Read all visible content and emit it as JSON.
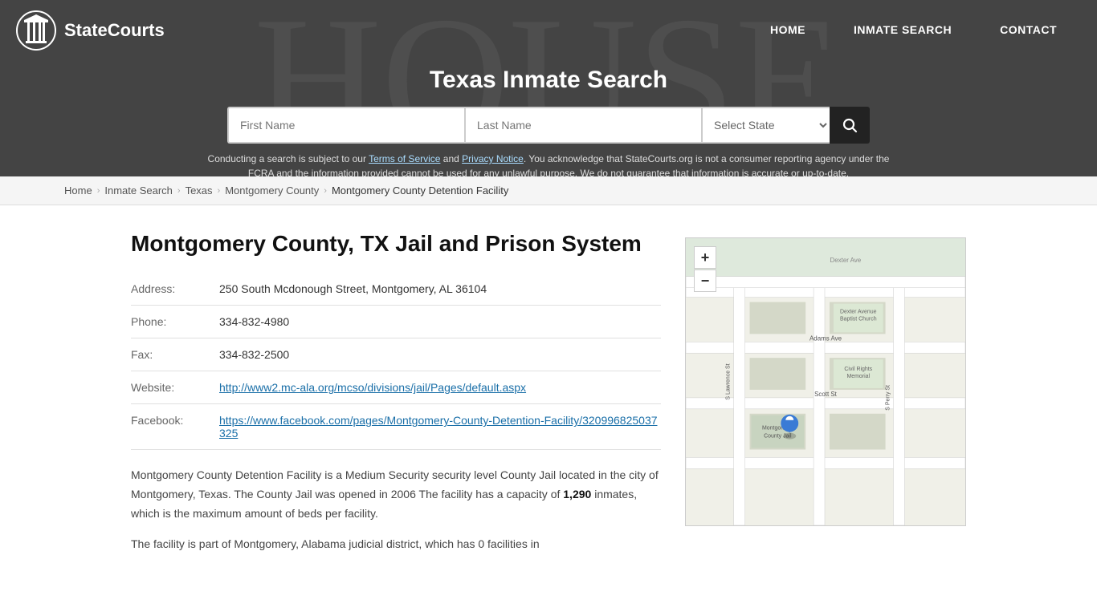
{
  "site": {
    "name": "StateCourts",
    "logo_alt": "StateCourts logo"
  },
  "nav": {
    "home_label": "HOME",
    "inmate_search_label": "INMATE SEARCH",
    "contact_label": "CONTACT"
  },
  "hero": {
    "title": "Texas Inmate Search",
    "search": {
      "first_name_placeholder": "First Name",
      "last_name_placeholder": "Last Name",
      "state_placeholder": "Select State",
      "search_icon": "search-icon"
    }
  },
  "disclaimer": {
    "text_before": "Conducting a search is subject to our ",
    "terms_label": "Terms of Service",
    "text_and": " and ",
    "privacy_label": "Privacy Notice",
    "text_after": ". You acknowledge that StateCourts.org is not a consumer reporting agency under the FCRA and the information provided cannot be used for any unlawful purpose. We do not guarantee that information is accurate or up-to-date."
  },
  "breadcrumb": {
    "home": "Home",
    "inmate_search": "Inmate Search",
    "texas": "Texas",
    "county": "Montgomery County",
    "facility": "Montgomery County Detention Facility"
  },
  "facility": {
    "title": "Montgomery County, TX Jail and Prison System",
    "address_label": "Address:",
    "address_value": "250 South Mcdonough Street, Montgomery, AL 36104",
    "phone_label": "Phone:",
    "phone_value": "334-832-4980",
    "fax_label": "Fax:",
    "fax_value": "334-832-2500",
    "website_label": "Website:",
    "website_url": "http://www2.mc-ala.org/mcso/divisions/jail/Pages/default.aspx",
    "website_display": "http://www2.mc-ala.org/mcso/divisions/jail/Pages/default.aspx",
    "facebook_label": "Facebook:",
    "facebook_url": "https://www.facebook.com/pages/Montgomery-County-Detention-Facility/320996825037325",
    "facebook_display": "https://www.facebook.com/pages/Montgomery-County-Detention-Facility/320996825037325",
    "description_1": "Montgomery County Detention Facility is a Medium Security security level County Jail located in the city of Montgomery, Texas. The County Jail was opened in 2006 The facility has a capacity of ",
    "capacity": "1,290",
    "description_1_after": " inmates, which is the maximum amount of beds per facility.",
    "description_2": "The facility is part of Montgomery, Alabama judicial district, which has 0 facilities in"
  },
  "map": {
    "zoom_in": "+",
    "zoom_out": "−",
    "streets": [
      "Dexter Ave",
      "Adams Ave",
      "Scott St",
      "S Lawrence St",
      "S Perry St"
    ],
    "poi": [
      "Dexter Avenue Baptist Church",
      "Civil Rights Memorial",
      "Montgomery County Jail"
    ]
  }
}
